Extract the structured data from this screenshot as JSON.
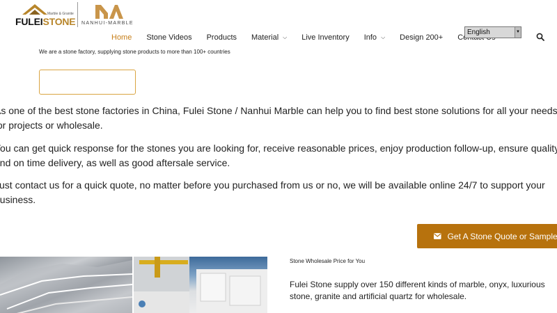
{
  "brand": {
    "fulei_small": "Marble & Granite",
    "fulei_word_a": "FULEI",
    "fulei_word_b": "STONE",
    "nanhui_word": "NANHUI-MARBLE",
    "accent_color": "#b8862b"
  },
  "nav": {
    "items": [
      {
        "label": "Home",
        "active": true,
        "dropdown": false
      },
      {
        "label": "Stone Videos",
        "dropdown": false
      },
      {
        "label": "Products",
        "dropdown": false
      },
      {
        "label": "Material",
        "dropdown": true
      },
      {
        "label": "Live Inventory",
        "dropdown": false
      },
      {
        "label": "Info",
        "dropdown": true
      },
      {
        "label": "Design 200+",
        "dropdown": false
      },
      {
        "label": "Contact Us",
        "dropdown": false
      }
    ],
    "active_color": "#c77f1a"
  },
  "language": {
    "selected": "English"
  },
  "search": {
    "icon": "search-icon"
  },
  "tagline": "We are a stone factory, supplying stone products to more than 100+ countries",
  "paragraphs": [
    "As one of the best stone factories in China, Fulei Stone / Nanhui Marble can help you to find best stone solutions for all your needs for projects or wholesale.",
    "You can get quick response for the stones you are looking for,  receive reasonable prices, enjoy production follow-up, ensure quality and on time delivery,  as well as good aftersale service.",
    "Just contact us for a quick quote, no matter before you purchased from us or no, we will be available online 24/7 to support your business."
  ],
  "quote_button": {
    "label": "Get A Stone Quote or Sample!",
    "icon": "envelope-icon",
    "color": "#b7720d"
  },
  "wholesale": {
    "title": "Stone Wholesale Price for You",
    "text": "Fulei Stone supply over 150 different kinds of marble, onyx, luxurious stone, granite and artificial quartz for wholesale."
  }
}
